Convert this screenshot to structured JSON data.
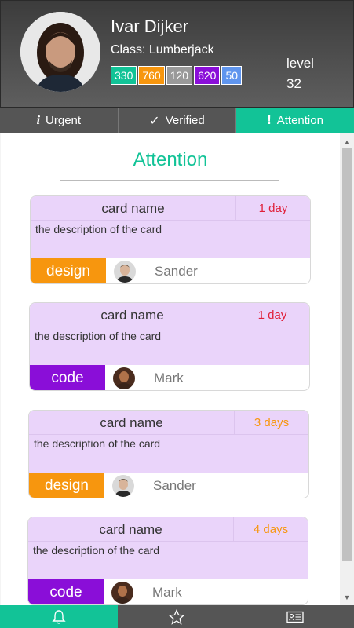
{
  "profile": {
    "name": "Ivar Dijker",
    "class_label": "Class: Lumberjack",
    "level_label": "level",
    "level_value": "32",
    "stats": [
      {
        "value": "330",
        "color": "#12c397"
      },
      {
        "value": "760",
        "color": "#f7960e"
      },
      {
        "value": "120",
        "color": "#9a9a9a"
      },
      {
        "value": "620",
        "color": "#8a0ed8"
      },
      {
        "value": "50",
        "color": "#5f95ee"
      }
    ]
  },
  "tabs": [
    {
      "label": "Urgent",
      "icon": "info-icon",
      "active": false
    },
    {
      "label": "Verified",
      "icon": "checkmark-icon",
      "active": false
    },
    {
      "label": "Attention",
      "icon": "exclamation-icon",
      "active": true
    }
  ],
  "section": {
    "title": "Attention"
  },
  "cards": [
    {
      "name": "card name",
      "due": "1 day",
      "due_color": "#e0203a",
      "description": "the description of the card",
      "tag": "design",
      "tag_color": "#f7960e",
      "user": "Sander"
    },
    {
      "name": "card name",
      "due": "1 day",
      "due_color": "#e0203a",
      "description": "the description of the card",
      "tag": "code",
      "tag_color": "#8a0ed8",
      "user": "Mark"
    },
    {
      "name": "card name",
      "due": "3 days",
      "due_color": "#f7960e",
      "description": "the description of the card",
      "tag": "design",
      "tag_color": "#f7960e",
      "user": "Sander"
    },
    {
      "name": "card name",
      "due": "4 days",
      "due_color": "#f7960e",
      "description": "the description of the card",
      "tag": "code",
      "tag_color": "#8a0ed8",
      "user": "Mark"
    }
  ],
  "bottom_nav": [
    {
      "icon": "bell-icon",
      "active": true
    },
    {
      "icon": "star-icon",
      "active": false
    },
    {
      "icon": "id-card-icon",
      "active": false
    }
  ],
  "colors": {
    "accent": "#12c397",
    "card_bg": "#ead4fa"
  }
}
